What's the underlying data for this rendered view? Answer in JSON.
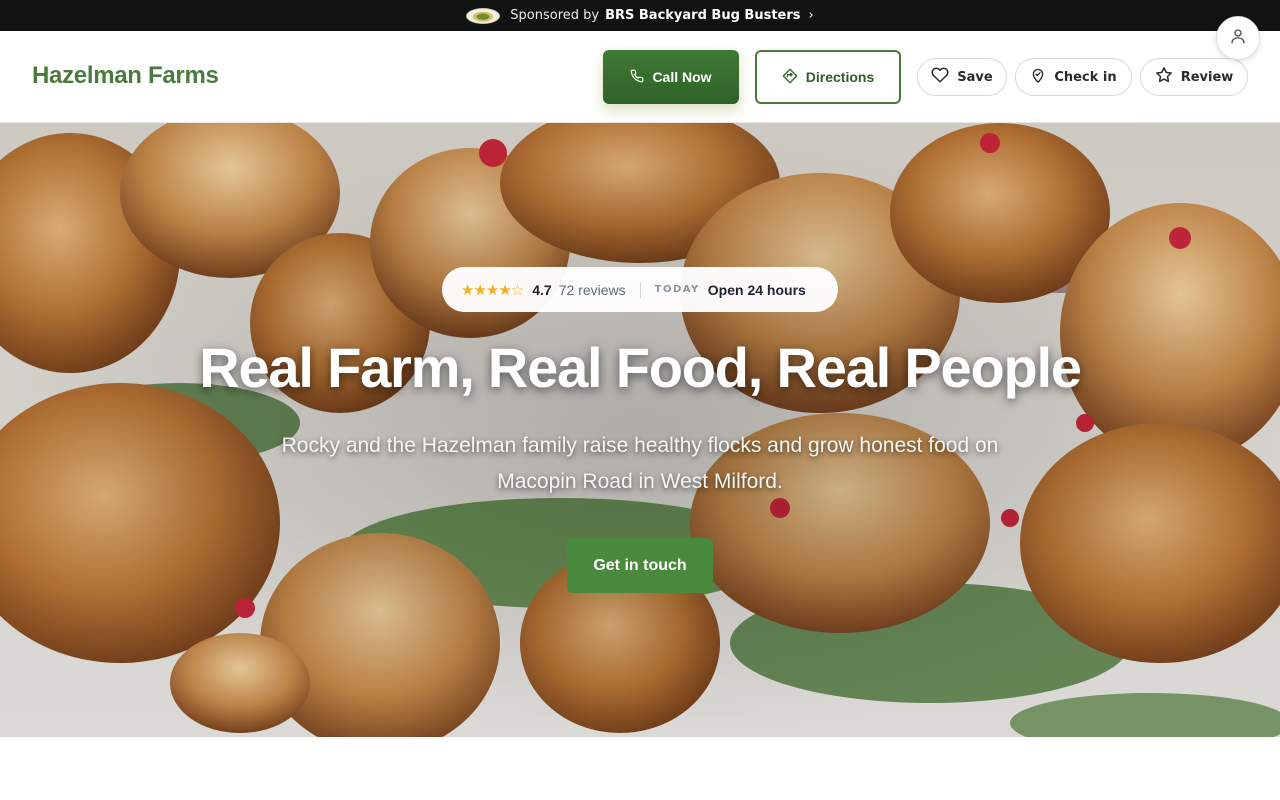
{
  "sponsor": {
    "prefix": "Sponsored by",
    "name": "BRS Backyard Bug Busters",
    "chevron": "›",
    "logo_icon": "sponsor-logo"
  },
  "header": {
    "brand": "Hazelman Farms",
    "actions": {
      "call": {
        "label": "Call Now",
        "icon": "phone-icon"
      },
      "directions": {
        "label": "Directions",
        "icon": "directions-icon"
      },
      "save": {
        "label": "Save",
        "icon": "heart-icon"
      },
      "checkin": {
        "label": "Check in",
        "icon": "map-pin-icon"
      },
      "review": {
        "label": "Review",
        "icon": "star-icon"
      }
    },
    "account_icon": "user-icon"
  },
  "hero": {
    "rating": {
      "stars": "★★★★☆",
      "value": "4.7",
      "reviews": "72 reviews",
      "today_label": "TODAY",
      "hours": "Open 24 hours"
    },
    "title": "Real Farm, Real Food, Real People",
    "subtitle": "Rocky and the Hazelman family raise healthy flocks and grow honest food on Macopin Road in West Milford.",
    "cta": "Get in touch",
    "image_subject": "hens-foraging-photo"
  },
  "colors": {
    "brand_green": "#4a7a3c",
    "call_green": "#3a7030",
    "cta_green": "#4a8a3e",
    "star_gold": "#f2b01e",
    "sponsor_bar": "#0f1413"
  }
}
